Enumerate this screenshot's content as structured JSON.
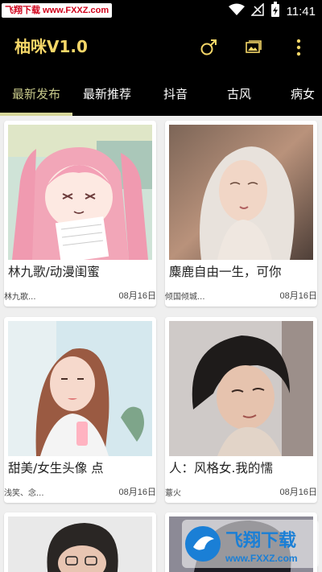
{
  "status_bar": {
    "watermark": "飞翔下载 www.FXXZ.com",
    "time": "11:41"
  },
  "app_bar": {
    "title": "柚咪V1.0",
    "icons": [
      "male-icon",
      "gallery-icon",
      "more-icon"
    ],
    "accent_color": "#f5d768"
  },
  "tabs": [
    {
      "label": "最新发布",
      "active": true
    },
    {
      "label": "最新推荐",
      "active": false
    },
    {
      "label": "抖音",
      "active": false
    },
    {
      "label": "古风",
      "active": false
    },
    {
      "label": "病女",
      "active": false
    }
  ],
  "cards": [
    {
      "title": "林九歌/动漫闺蜜",
      "author": "林九歌...",
      "date": "08月16日"
    },
    {
      "title": "麋鹿自由一生，可你",
      "author": "倾国倾城...",
      "date": "08月16日"
    },
    {
      "title": "甜美/女生头像 点",
      "author": "浅笑、念...",
      "date": "08月16日"
    },
    {
      "title": "人：风格女.我的懦",
      "author": "薏火",
      "date": "08月16日"
    }
  ],
  "watermark_bottom": {
    "brand": "飞翔下载",
    "url": "www.FXXZ.com"
  }
}
